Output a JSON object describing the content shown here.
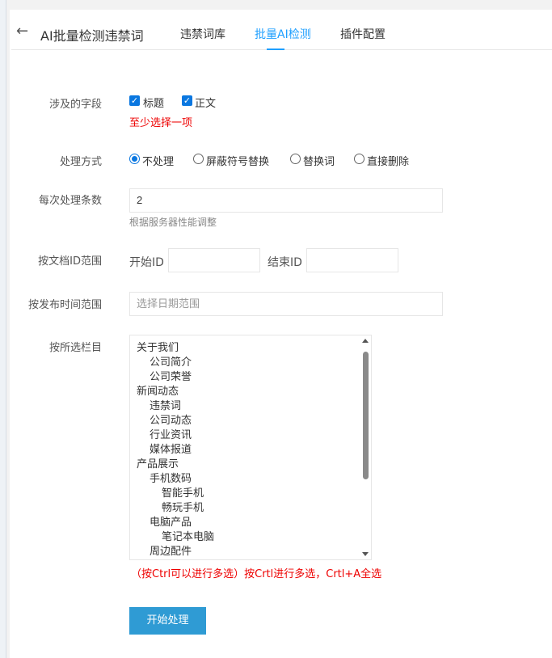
{
  "header": {
    "back_icon": "←",
    "title": "AI批量检测违禁词",
    "tabs": [
      {
        "label": "违禁词库"
      },
      {
        "label": "批量AI检测"
      },
      {
        "label": "插件配置"
      }
    ],
    "active_tab": "批量AI检测",
    "accent_color": "#1e9fff"
  },
  "form": {
    "fields": {
      "label": "涉及的字段",
      "options": [
        {
          "label": "标题",
          "checked": true
        },
        {
          "label": "正文",
          "checked": true
        }
      ],
      "error": "至少选择一项"
    },
    "mode": {
      "label": "处理方式",
      "options": [
        {
          "label": "不处理",
          "selected": true
        },
        {
          "label": "屏蔽符号替换",
          "selected": false
        },
        {
          "label": "替换词",
          "selected": false
        },
        {
          "label": "直接删除",
          "selected": false
        }
      ]
    },
    "batch": {
      "label": "每次处理条数",
      "value": "2",
      "hint": "根据服务器性能调整"
    },
    "idrange": {
      "label": "按文档ID范围",
      "start_label": "开始ID",
      "start_value": "",
      "end_label": "结束ID",
      "end_value": ""
    },
    "daterange": {
      "label": "按发布时间范围",
      "placeholder": "选择日期范围"
    },
    "category": {
      "label": "按所选栏目",
      "items": [
        {
          "text": "关于我们",
          "level": 0
        },
        {
          "text": "公司简介",
          "level": 1
        },
        {
          "text": "公司荣誉",
          "level": 1
        },
        {
          "text": "新闻动态",
          "level": 0
        },
        {
          "text": "违禁词",
          "level": 1
        },
        {
          "text": "公司动态",
          "level": 1
        },
        {
          "text": "行业资讯",
          "level": 1
        },
        {
          "text": "媒体报道",
          "level": 1
        },
        {
          "text": "产品展示",
          "level": 0
        },
        {
          "text": "手机数码",
          "level": 1
        },
        {
          "text": "智能手机",
          "level": 2
        },
        {
          "text": "畅玩手机",
          "level": 2
        },
        {
          "text": "电脑产品",
          "level": 1
        },
        {
          "text": "笔记本电脑",
          "level": 2
        },
        {
          "text": "周边配件",
          "level": 1
        }
      ],
      "note": "（按Ctrl可以进行多选）按Crtl进行多选，Crtl+A全选"
    },
    "submit_label": "开始处理",
    "submit_color": "#2f9bd4",
    "error_color": "#e00000"
  }
}
